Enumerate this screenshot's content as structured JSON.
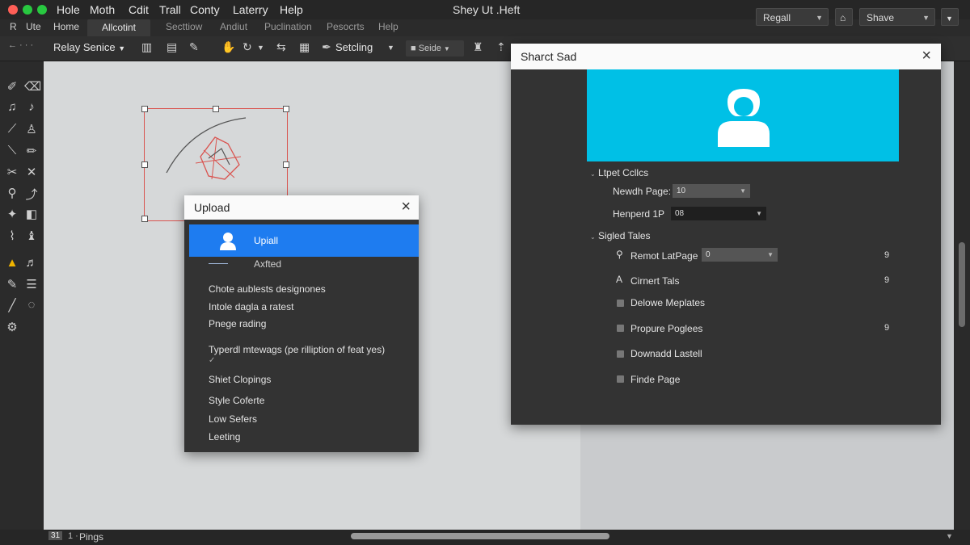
{
  "menubar": {
    "items": [
      "Hole",
      "Moth",
      "Cdit",
      "Trall",
      "Conty",
      "Laterry",
      "Help"
    ],
    "title": "Shey Ut .Heft",
    "right_dropdown_1": "Regall",
    "right_dropdown_2": "Shave"
  },
  "tabrow": {
    "left_label": "R",
    "left_label_2": "Ute",
    "tabs": [
      "Home",
      "Allcotint",
      "Secttiow",
      "Andiut",
      "Puclination",
      "Pesocrts",
      "Help"
    ],
    "active_tab": "Allcotint"
  },
  "toolbar": {
    "relay": "Relay Senice",
    "setting": "Setcling",
    "select_label": "Seide"
  },
  "upload_dialog": {
    "title": "Upload",
    "selected_item": "Upiall",
    "second_item": "Axfted",
    "items": [
      "Chote aublests designones",
      "Intole dagla a ratest",
      "Pnege rading",
      "Typerdl mtewags (pe rilliption of feat yes)",
      "Shiet Clopings",
      "Style Coferte",
      "Low Sefers",
      "Leeting"
    ],
    "check_mark": "✓"
  },
  "share_dialog": {
    "title": "Sharct Sad",
    "section1": {
      "label": "Ltpet Ccllcs",
      "rows": [
        {
          "label": "Newdh Page:",
          "value": "10"
        },
        {
          "label": "Henperd 1P",
          "value": "08"
        }
      ]
    },
    "section2": {
      "label": "Sigled Tales",
      "rows": [
        {
          "label": "Remot LatPage",
          "value": "0",
          "right": "9"
        },
        {
          "label": "Cirnert Tals",
          "right": "9"
        },
        {
          "label": "Delowe Meplates"
        },
        {
          "label": "Propure Poglees",
          "right": "9"
        },
        {
          "label": "Downadd Lastell"
        },
        {
          "label": "Finde Page"
        }
      ]
    }
  },
  "statusbar": {
    "left_box": "31",
    "sep": "1 ·",
    "label": "Pings"
  },
  "colors": {
    "accent_blue": "#1e7cf0",
    "banner_cyan": "#00c0e6",
    "selection_red": "#d9534f",
    "traffic_red": "#ff5f57",
    "traffic_yellow": "#febc2e",
    "traffic_green": "#28c840"
  }
}
